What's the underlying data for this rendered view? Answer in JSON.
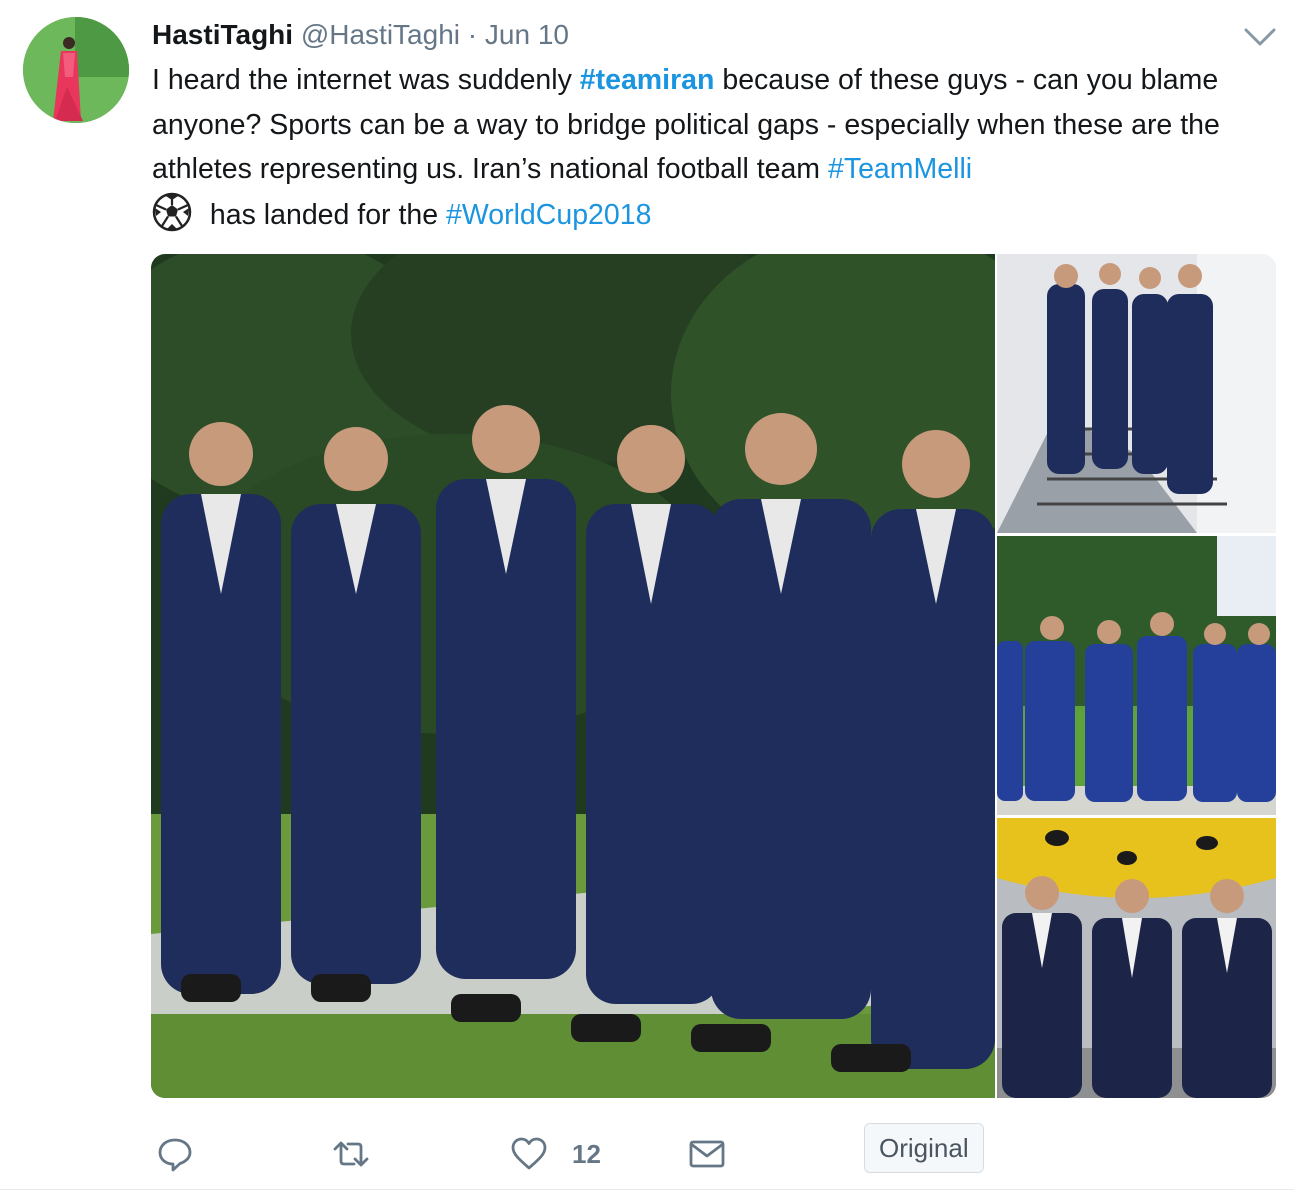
{
  "tweet": {
    "author_name": "HastiTaghi",
    "author_handle": "@HastiTaghi",
    "separator": "·",
    "date": "Jun 10",
    "text_parts": {
      "t1": "I heard the internet was suddenly ",
      "h1": "#teamiran",
      "t2": " because of these guys - can you blame anyone? Sports can be a way to bridge political gaps - especially when these are the athletes representing us. Iran’s national football team ",
      "h2": "#TeamMelli",
      "t3": " has landed for the ",
      "h3": "#WorldCup2018"
    },
    "emoji": "soccer-ball-icon"
  },
  "media": {
    "photos": [
      {
        "description_icon": "team-in-suits-on-lawn"
      },
      {
        "description_icon": "team-on-staircase"
      },
      {
        "description_icon": "team-lined-up-outdoors"
      },
      {
        "description_icon": "team-by-airplane"
      }
    ]
  },
  "actions": {
    "reply_icon": "reply-icon",
    "retweet_icon": "retweet-icon",
    "like_icon": "heart-icon",
    "like_count": "12",
    "dm_icon": "envelope-icon",
    "original_label": "Original"
  },
  "colors": {
    "link": "#1b95e0",
    "secondary_text": "#657786",
    "primary_text": "#14171a",
    "suit_navy": "#1f2d5c"
  }
}
